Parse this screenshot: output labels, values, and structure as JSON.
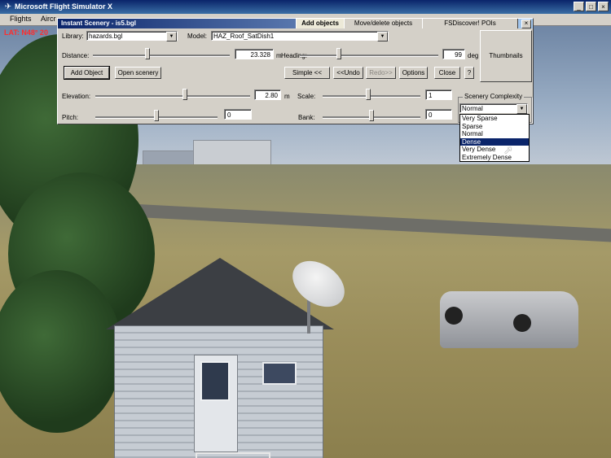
{
  "window": {
    "title": "Microsoft Flight Simulator X",
    "buttons": [
      "_",
      "□",
      "×"
    ]
  },
  "menubar": {
    "items": [
      "Flights",
      "Aircr"
    ]
  },
  "hud": {
    "text": "LAT: N48° 20"
  },
  "panel": {
    "title": "Instant Scenery - is5.bgl",
    "tabs": [
      "Add objects",
      "Move/delete objects",
      "FSDiscover! POIs"
    ],
    "close": "×",
    "library": {
      "label": "Library:",
      "value": "hazards.bgl"
    },
    "model": {
      "label": "Model:",
      "value": "HAZ_Roof_SatDish1"
    },
    "thumbnails": "Thumbnails",
    "distance": {
      "label": "Distance:",
      "value": "23.328",
      "unit": "m",
      "slider": 0.4
    },
    "heading": {
      "label": "Heading:",
      "value": "99",
      "unit": "deg",
      "slider": 0.28
    },
    "buttons": {
      "add_object": "Add Object",
      "open_scenery": "Open scenery",
      "simple": "Simple <<",
      "undo": "<<Undo",
      "redo": "Redo>>",
      "options": "Options",
      "close": "Close",
      "help": "?"
    },
    "elevation": {
      "label": "Elevation:",
      "value": "2.80",
      "unit": "m",
      "slider": 0.58
    },
    "scale": {
      "label": "Scale:",
      "value": "1",
      "slider": 0.47
    },
    "pitch": {
      "label": "Pitch:",
      "value": "0",
      "slider": 0.5
    },
    "bank": {
      "label": "Bank:",
      "value": "0",
      "slider": 0.5
    },
    "complexity": {
      "label": "Scenery Complexity",
      "value": "Normal",
      "options": [
        "Very Sparse",
        "Sparse",
        "Normal",
        "Dense",
        "Very Dense",
        "Extremely Dense"
      ],
      "highlighted": "Dense"
    }
  }
}
